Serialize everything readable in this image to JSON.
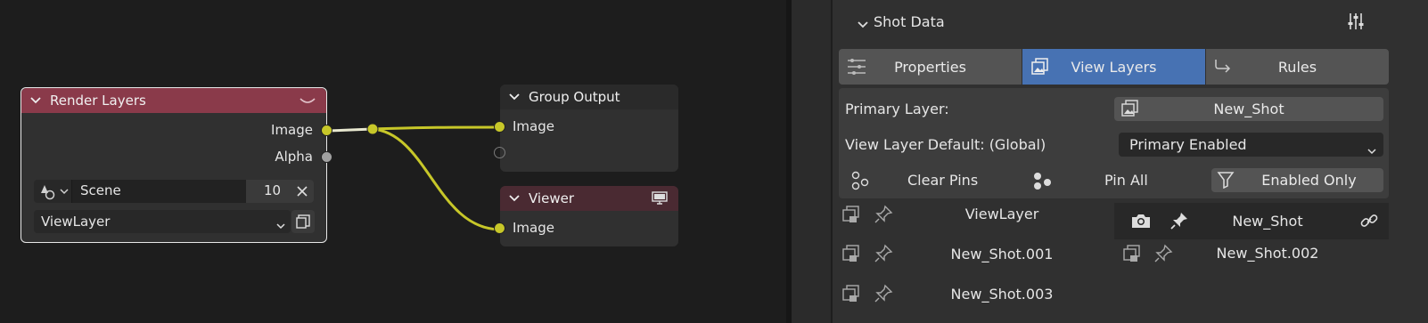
{
  "nodes": {
    "render_layers": {
      "title": "Render Layers",
      "outputs": [
        "Image",
        "Alpha"
      ],
      "scene_label": "Scene",
      "scene_value": "10",
      "view_layer": "ViewLayer"
    },
    "group_output": {
      "title": "Group Output",
      "input": "Image"
    },
    "viewer": {
      "title": "Viewer",
      "input": "Image"
    }
  },
  "panel": {
    "section_title": "Shot Data",
    "tabs": [
      "Properties",
      "View Layers",
      "Rules"
    ],
    "active_tab": "View Layers",
    "primary_layer_label": "Primary Layer:",
    "primary_layer_value": "New_Shot",
    "default_label": "View Layer Default: (Global)",
    "default_value": "Primary Enabled",
    "clear_pins": "Clear Pins",
    "pin_all": "Pin All",
    "enabled_only": "Enabled Only",
    "layers": [
      "ViewLayer",
      "New_Shot",
      "New_Shot.001",
      "New_Shot.002",
      "New_Shot.003"
    ]
  },
  "colors": {
    "render_header": "#8a3a4a",
    "viewer_header": "#4a2a32",
    "group_header": "#2a2a2a",
    "link": "#c7c729",
    "active_tab": "#4772b3"
  },
  "icons": [
    "chevron-down-icon",
    "collapse-icon",
    "scene-icon",
    "close-icon",
    "dropdown-arrow-icon",
    "new-layer-icon",
    "monitor-icon",
    "settings-sliders-icon",
    "view-layers-icon",
    "rules-icon",
    "pins-icon",
    "pin-all-icon",
    "filter-icon",
    "camera-icon",
    "pin-icon",
    "link-icon"
  ]
}
